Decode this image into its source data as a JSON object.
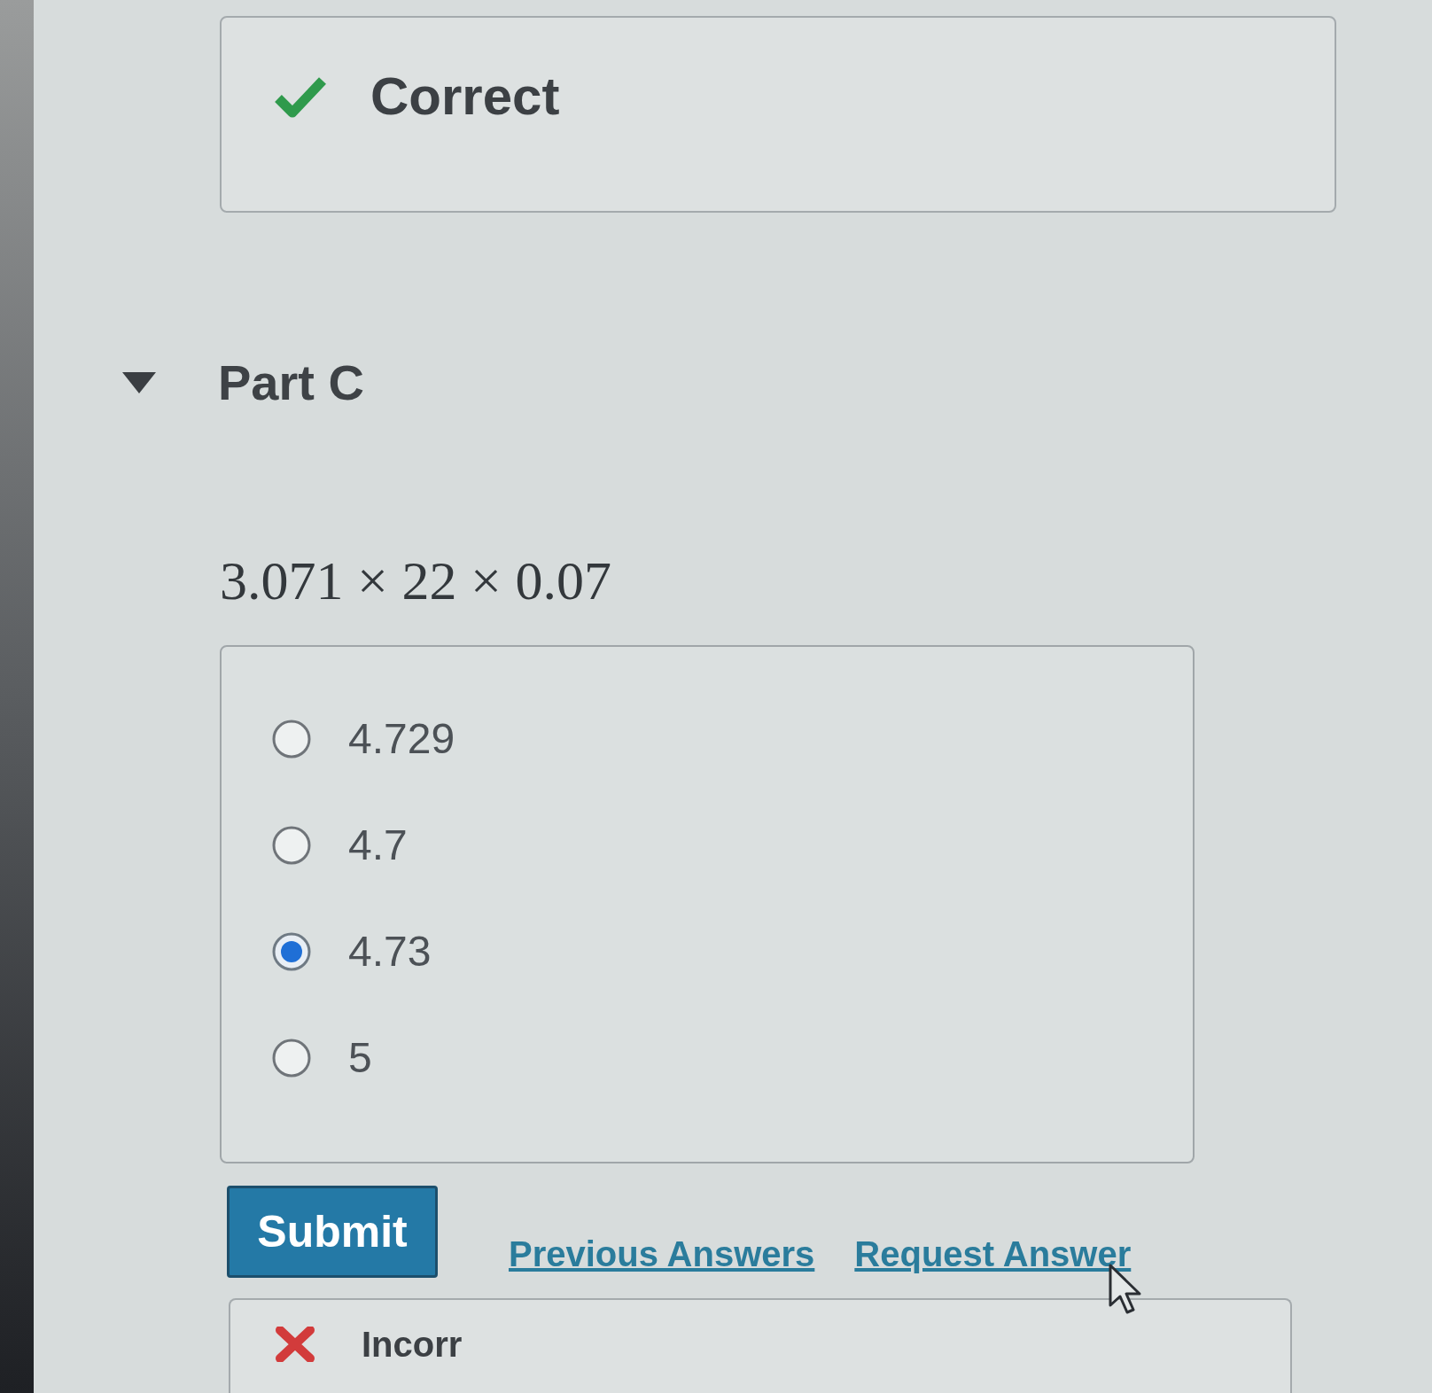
{
  "feedback_top": {
    "kind": "correct",
    "label": "Correct"
  },
  "part": {
    "title": "Part C",
    "expanded": true
  },
  "expression": "3.071 × 22 × 0.07",
  "options": [
    {
      "label": "4.729",
      "selected": false
    },
    {
      "label": "4.7",
      "selected": false
    },
    {
      "label": "4.73",
      "selected": true
    },
    {
      "label": "5",
      "selected": false
    }
  ],
  "actions": {
    "submit": "Submit",
    "links": [
      "Previous Answers",
      "Request Answer"
    ]
  },
  "feedback_bottom": {
    "kind": "incorrect",
    "label": "Incorr"
  }
}
